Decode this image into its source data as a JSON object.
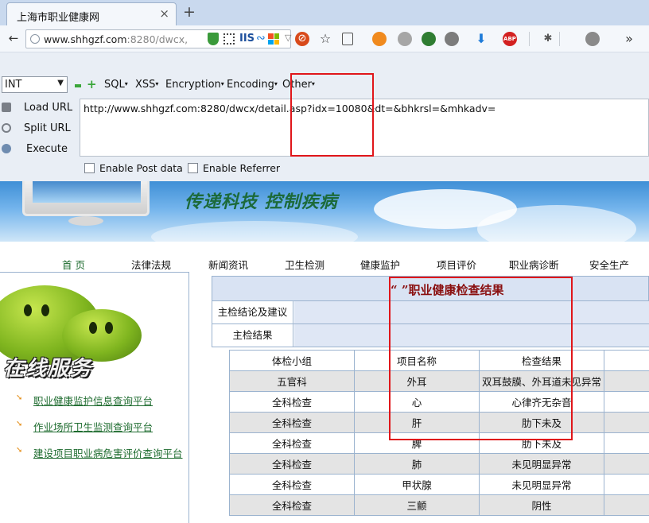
{
  "browser": {
    "tab_title": "上海市职业健康网",
    "tab_close": "×",
    "new_tab": "+",
    "url_host": "www.shhgzf.com",
    "url_rest": ":8280/dwcx,",
    "iis_label": "IIS",
    "wave_glyph": "∾",
    "more_glyph": "»",
    "abp_label": "ABP"
  },
  "hackbar": {
    "select_value": "INT",
    "menus": [
      "SQL",
      "XSS",
      "Encryption",
      "Encoding",
      "Other"
    ],
    "actions": {
      "load": "Load URL",
      "split": "Split URL",
      "execute": "Execute"
    },
    "url_value": "http://www.shhgzf.com:8280/dwcx/detail.asp?idx=10080&dt=&bhkrsl=&mhkadv=",
    "post_label": "Enable Post data",
    "referrer_label": "Enable Referrer"
  },
  "banner": {
    "slogan": "传递科技  控制疾病"
  },
  "site_nav": [
    "首 页",
    "法律法规",
    "新闻资讯",
    "卫生检测",
    "健康监护",
    "项目评价",
    "职业病诊断",
    "安全生产"
  ],
  "sidebar": {
    "brand_text": "在线服务",
    "links": [
      "职业健康监护信息查询平台",
      "作业场所卫生监测查询平台",
      "建设项目职业病危害评价查询平台"
    ]
  },
  "result": {
    "title": "“ ”职业健康检查结果",
    "conclusion_label": "主检结论及建议",
    "main_result_label": "主检结果",
    "columns": [
      "体检小组",
      "项目名称",
      "检查结果",
      ""
    ],
    "rows": [
      [
        "五官科",
        "外耳",
        "双耳鼓膜、外耳道未见异常",
        ""
      ],
      [
        "全科检查",
        "心",
        "心律齐无杂音",
        ""
      ],
      [
        "全科检查",
        "肝",
        "肋下未及",
        ""
      ],
      [
        "全科检查",
        "脾",
        "肋下未及",
        ""
      ],
      [
        "全科检查",
        "肺",
        "未见明显异常",
        ""
      ],
      [
        "全科检查",
        "甲状腺",
        "未见明显异常",
        ""
      ],
      [
        "全科检查",
        "三颤",
        "阴性",
        ""
      ]
    ]
  },
  "colors": {
    "highlight": "#e0161a",
    "title_red": "#8a1010",
    "link_green": "#1d6b2e"
  }
}
